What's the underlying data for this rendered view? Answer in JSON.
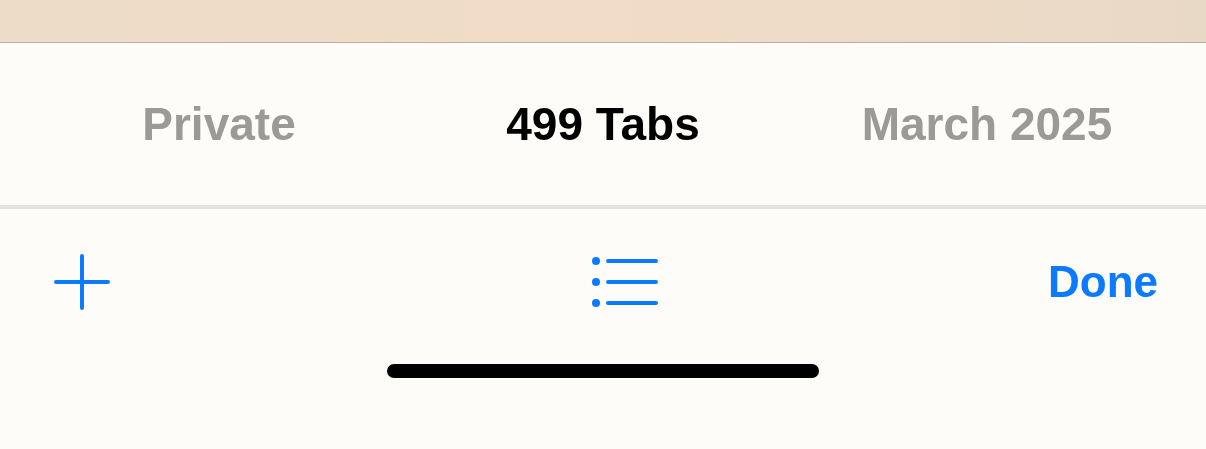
{
  "tabs": [
    {
      "label": "Private",
      "selected": false
    },
    {
      "label": "499 Tabs",
      "selected": true
    },
    {
      "label": "March 2025",
      "selected": false
    }
  ],
  "toolbar": {
    "done_button": "Done"
  }
}
